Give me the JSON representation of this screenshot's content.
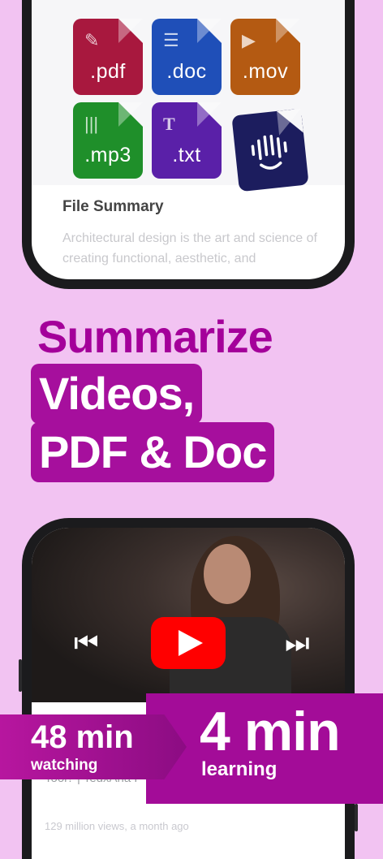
{
  "files": [
    {
      "ext": ".pdf",
      "color": "#a8183e",
      "icon": "pdf-icon"
    },
    {
      "ext": ".doc",
      "color": "#1f4fb8",
      "icon": "doc-icon"
    },
    {
      "ext": ".mov",
      "color": "#b45a12",
      "icon": "play-icon"
    },
    {
      "ext": ".mp3",
      "color": "#1f8f2a",
      "icon": "audio-icon"
    },
    {
      "ext": ".txt",
      "color": "#5a20a8",
      "icon": "text-icon"
    },
    {
      "ext": "",
      "color": "#1c1d5e",
      "icon": "app-logo-icon"
    }
  ],
  "summary": {
    "title": "File Summary",
    "text": "Architectural design is the art and science of creating functional, aesthetic, and"
  },
  "headline": {
    "line1": "Summarize",
    "line2": "Videos,",
    "line3": "PDF & Doc"
  },
  "video": {
    "title_partial": "Tool? | TedxAna P",
    "meta_partial": "129 million views, a month ago"
  },
  "banner": {
    "before_time": "48 min",
    "before_label": "watching",
    "after_time": "4 min",
    "after_label": "learning"
  },
  "colors": {
    "background": "#f2c3f2",
    "accent": "#a60f9d",
    "youtube_red": "#ff0000"
  }
}
